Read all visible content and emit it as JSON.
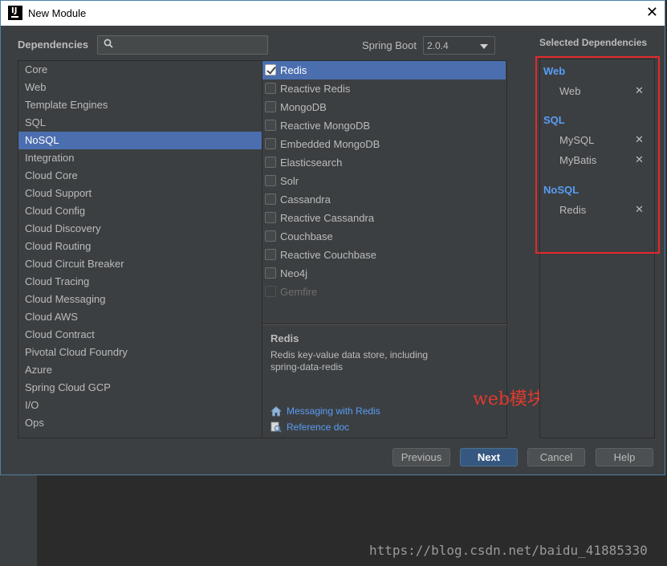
{
  "window": {
    "title": "New Module",
    "close_glyph": "✕"
  },
  "dependencies": {
    "label": "Dependencies",
    "search_placeholder": ""
  },
  "spring_boot": {
    "label": "Spring Boot",
    "value": "2.0.4"
  },
  "categories": [
    {
      "label": "Core",
      "selected": false
    },
    {
      "label": "Web",
      "selected": false
    },
    {
      "label": "Template Engines",
      "selected": false
    },
    {
      "label": "SQL",
      "selected": false
    },
    {
      "label": "NoSQL",
      "selected": true
    },
    {
      "label": "Integration",
      "selected": false
    },
    {
      "label": "Cloud Core",
      "selected": false
    },
    {
      "label": "Cloud Support",
      "selected": false
    },
    {
      "label": "Cloud Config",
      "selected": false
    },
    {
      "label": "Cloud Discovery",
      "selected": false
    },
    {
      "label": "Cloud Routing",
      "selected": false
    },
    {
      "label": "Cloud Circuit Breaker",
      "selected": false
    },
    {
      "label": "Cloud Tracing",
      "selected": false
    },
    {
      "label": "Cloud Messaging",
      "selected": false
    },
    {
      "label": "Cloud AWS",
      "selected": false
    },
    {
      "label": "Cloud Contract",
      "selected": false
    },
    {
      "label": "Pivotal Cloud Foundry",
      "selected": false
    },
    {
      "label": "Azure",
      "selected": false
    },
    {
      "label": "Spring Cloud GCP",
      "selected": false
    },
    {
      "label": "I/O",
      "selected": false
    },
    {
      "label": "Ops",
      "selected": false
    }
  ],
  "deps": [
    {
      "label": "Redis",
      "checked": true,
      "selected": true,
      "disabled": false
    },
    {
      "label": "Reactive Redis",
      "checked": false,
      "selected": false,
      "disabled": false
    },
    {
      "label": "MongoDB",
      "checked": false,
      "selected": false,
      "disabled": false
    },
    {
      "label": "Reactive MongoDB",
      "checked": false,
      "selected": false,
      "disabled": false
    },
    {
      "label": "Embedded MongoDB",
      "checked": false,
      "selected": false,
      "disabled": false
    },
    {
      "label": "Elasticsearch",
      "checked": false,
      "selected": false,
      "disabled": false
    },
    {
      "label": "Solr",
      "checked": false,
      "selected": false,
      "disabled": false
    },
    {
      "label": "Cassandra",
      "checked": false,
      "selected": false,
      "disabled": false
    },
    {
      "label": "Reactive Cassandra",
      "checked": false,
      "selected": false,
      "disabled": false
    },
    {
      "label": "Couchbase",
      "checked": false,
      "selected": false,
      "disabled": false
    },
    {
      "label": "Reactive Couchbase",
      "checked": false,
      "selected": false,
      "disabled": false
    },
    {
      "label": "Neo4j",
      "checked": false,
      "selected": false,
      "disabled": false
    },
    {
      "label": "Gemfire",
      "checked": false,
      "selected": false,
      "disabled": true
    }
  ],
  "description": {
    "title": "Redis",
    "text": "Redis key-value data store, including spring-data-redis",
    "links": [
      {
        "label": "Messaging with Redis",
        "icon": "home-icon"
      },
      {
        "label": "Reference doc",
        "icon": "reference-doc-icon"
      }
    ]
  },
  "selected_deps": {
    "label": "Selected Dependencies",
    "remove_glyph": "✕",
    "groups": [
      {
        "name": "Web",
        "items": [
          "Web"
        ]
      },
      {
        "name": "SQL",
        "items": [
          "MySQL",
          "MyBatis"
        ]
      },
      {
        "name": "NoSQL",
        "items": [
          "Redis"
        ]
      }
    ]
  },
  "annotation": "web模块",
  "buttons": {
    "previous": "Previous",
    "next": "Next",
    "cancel": "Cancel",
    "help": "Help"
  },
  "watermark": "https://blog.csdn.net/baidu_41885330",
  "colors": {
    "selection": "#4b6eaf",
    "link": "#589df6",
    "annotation_red": "#e5282b",
    "primary_button": "#365880"
  }
}
